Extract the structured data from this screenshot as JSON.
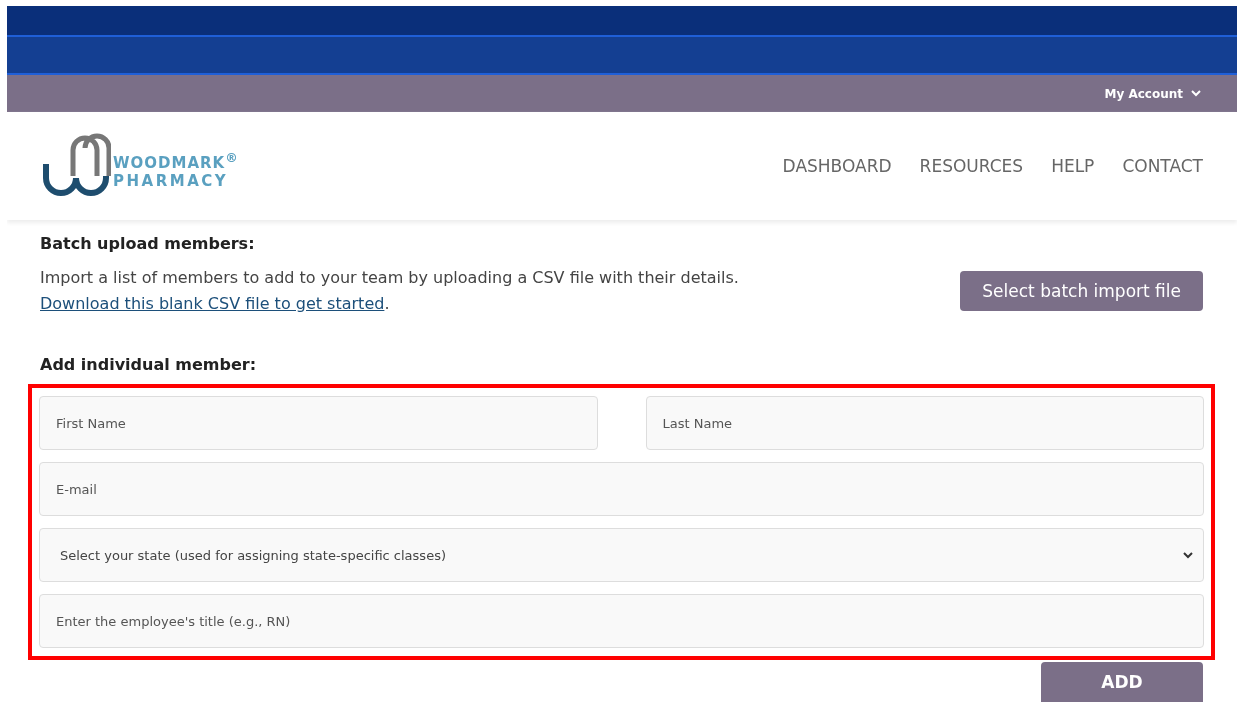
{
  "account_menu": {
    "label": "My Account"
  },
  "logo": {
    "line_1": "WOODMARK$^{®}$",
    "line_2": "PHARMACY"
  },
  "nav": [
    {
      "label": "DASHBOARD"
    },
    {
      "label": "RESOURCES"
    },
    {
      "label": "HELP"
    },
    {
      "label": "CONTACT"
    }
  ],
  "batch": {
    "heading": "Batch upload members:",
    "text": "Import a list of members to add to your team by uploading a CSV file with their details.",
    "link": "Download this blank CSV file to get started",
    "after_link": ".",
    "button": "Select batch import file"
  },
  "individual": {
    "heading": "Add individual member:",
    "highlighted": true,
    "rows": [
      [
        {
          "kind": "input",
          "placeholder": "First Name"
        },
        {
          "kind": "input",
          "placeholder": "Last Name"
        }
      ],
      [
        {
          "kind": "input",
          "placeholder": "E-mail"
        }
      ],
      [
        {
          "kind": "select",
          "text": "Select your state (used for assigning state-specific classes)"
        }
      ],
      [
        {
          "kind": "input",
          "placeholder": "Enter the employee's title (e.g., RN)"
        }
      ]
    ],
    "button": "ADD"
  }
}
